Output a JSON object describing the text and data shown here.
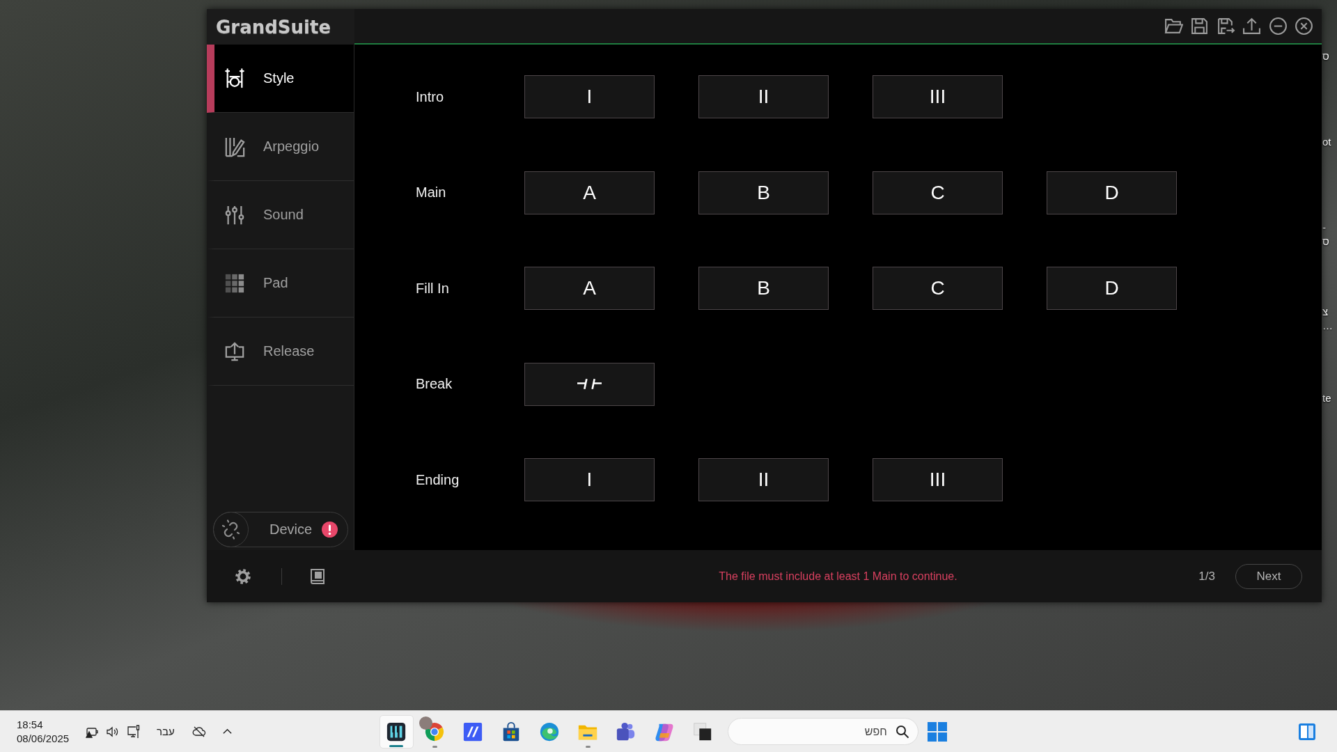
{
  "window": {
    "logo": "GrandSuite"
  },
  "sidebar": {
    "items": [
      {
        "label": "Style",
        "selected": true
      },
      {
        "label": "Arpeggio",
        "selected": false
      },
      {
        "label": "Sound",
        "selected": false
      },
      {
        "label": "Pad",
        "selected": false
      },
      {
        "label": "Release",
        "selected": false
      }
    ],
    "device": {
      "label": "Device",
      "alert": true
    }
  },
  "sections": [
    {
      "label": "Intro",
      "buttons": [
        {
          "kind": "text",
          "label": "I"
        },
        {
          "kind": "text",
          "label": "II"
        },
        {
          "kind": "text",
          "label": "III"
        }
      ]
    },
    {
      "label": "Main",
      "buttons": [
        {
          "kind": "text",
          "label": "A"
        },
        {
          "kind": "text",
          "label": "B"
        },
        {
          "kind": "text",
          "label": "C"
        },
        {
          "kind": "text",
          "label": "D"
        }
      ]
    },
    {
      "label": "Fill In",
      "buttons": [
        {
          "kind": "text",
          "label": "A"
        },
        {
          "kind": "text",
          "label": "B"
        },
        {
          "kind": "text",
          "label": "C"
        },
        {
          "kind": "text",
          "label": "D"
        }
      ]
    },
    {
      "label": "Break",
      "buttons": [
        {
          "kind": "symbol"
        }
      ]
    },
    {
      "label": "Ending",
      "buttons": [
        {
          "kind": "text",
          "label": "I"
        },
        {
          "kind": "text",
          "label": "II"
        },
        {
          "kind": "text",
          "label": "III"
        }
      ]
    }
  ],
  "footer": {
    "message": "The file must include at least 1 Main to continue.",
    "page": "1/3",
    "next": "Next"
  },
  "desktop": {
    "label_fragments": [
      {
        "lines": [
          "ס"
        ]
      },
      {
        "lines": [
          "ot"
        ]
      },
      {
        "lines": [
          "-",
          "ס"
        ]
      },
      {
        "lines": [
          "צ",
          "…"
        ]
      },
      {
        "lines": [
          "te"
        ]
      }
    ]
  },
  "taskbar": {
    "time": "18:54",
    "date": "08/06/2025",
    "language": "עבר",
    "apps": [
      {
        "selected": true,
        "running": true
      },
      {
        "selected": false,
        "running": true
      },
      {
        "selected": false,
        "running": false
      },
      {
        "selected": false,
        "running": false
      },
      {
        "selected": false,
        "running": false
      },
      {
        "selected": false,
        "running": true
      },
      {
        "selected": false,
        "running": false
      },
      {
        "selected": false,
        "running": false
      },
      {
        "selected": false,
        "running": false
      }
    ],
    "search": {
      "placeholder": "חפש"
    }
  }
}
